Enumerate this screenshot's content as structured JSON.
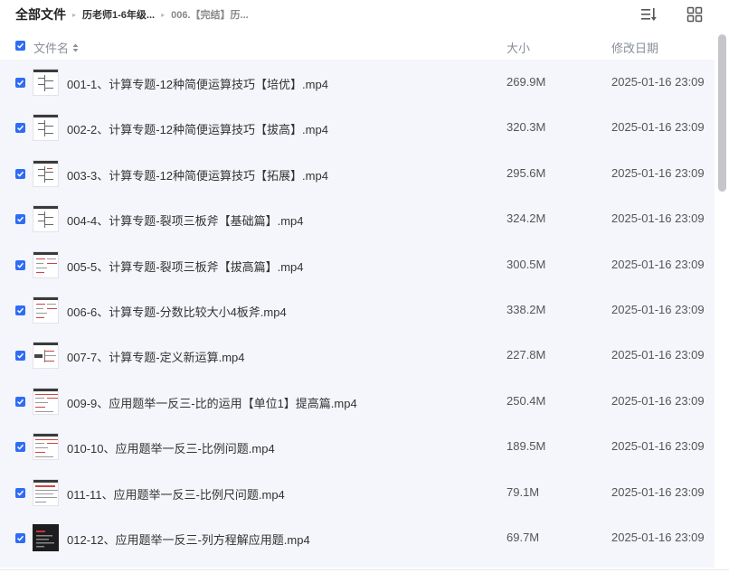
{
  "breadcrumb": {
    "root": "全部文件",
    "level1": "历老师1-6年级...",
    "level2": "006.【完结】历..."
  },
  "toolbar": {
    "sort_icon": "sort-list-icon",
    "grid_icon": "grid-view-icon"
  },
  "columns": {
    "name": "文件名",
    "size": "大小",
    "date": "修改日期"
  },
  "files": [
    {
      "name": "001-1、计算专题-12种简便运算技巧【培优】.mp4",
      "size": "269.9M",
      "date": "2025-01-16 23:09",
      "checked": true
    },
    {
      "name": "002-2、计算专题-12种简便运算技巧【拔高】.mp4",
      "size": "320.3M",
      "date": "2025-01-16 23:09",
      "checked": true
    },
    {
      "name": "003-3、计算专题-12种简便运算技巧【拓展】.mp4",
      "size": "295.6M",
      "date": "2025-01-16 23:09",
      "checked": true
    },
    {
      "name": "004-4、计算专题-裂项三板斧【基础篇】.mp4",
      "size": "324.2M",
      "date": "2025-01-16 23:09",
      "checked": true
    },
    {
      "name": "005-5、计算专题-裂项三板斧【拔高篇】.mp4",
      "size": "300.5M",
      "date": "2025-01-16 23:09",
      "checked": true
    },
    {
      "name": "006-6、计算专题-分数比较大小4板斧.mp4",
      "size": "338.2M",
      "date": "2025-01-16 23:09",
      "checked": true
    },
    {
      "name": "007-7、计算专题-定义新运算.mp4",
      "size": "227.8M",
      "date": "2025-01-16 23:09",
      "checked": true
    },
    {
      "name": "009-9、应用题举一反三-比的运用【单位1】提高篇.mp4",
      "size": "250.4M",
      "date": "2025-01-16 23:09",
      "checked": true
    },
    {
      "name": "010-10、应用题举一反三-比例问题.mp4",
      "size": "189.5M",
      "date": "2025-01-16 23:09",
      "checked": true
    },
    {
      "name": "011-11、应用题举一反三-比例尺问题.mp4",
      "size": "79.1M",
      "date": "2025-01-16 23:09",
      "checked": true
    },
    {
      "name": "012-12、应用题举一反三-列方程解应用题.mp4",
      "size": "69.7M",
      "date": "2025-01-16 23:09",
      "checked": true
    }
  ],
  "colors": {
    "accent": "#2f6cf6",
    "list_bg": "#f5f6fb",
    "muted_text": "#8a8f99"
  }
}
